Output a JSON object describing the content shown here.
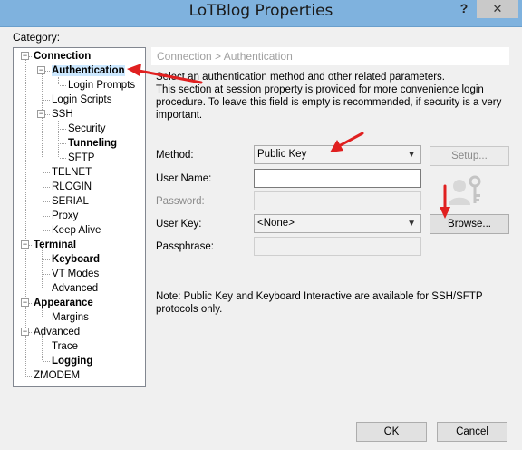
{
  "window": {
    "title": "LoTBlog Properties",
    "help_label": "?",
    "close_label": "✕"
  },
  "category_label": "Category:",
  "tree": [
    {
      "label": "Connection",
      "bold": true,
      "expander": "−"
    },
    {
      "label": "Authentication",
      "bold": true,
      "expander": "−",
      "selected": true
    },
    {
      "label": "Login Prompts",
      "bold": false
    },
    {
      "label": "Login Scripts",
      "bold": false
    },
    {
      "label": "SSH",
      "bold": false,
      "expander": "−"
    },
    {
      "label": "Security",
      "bold": false
    },
    {
      "label": "Tunneling",
      "bold": true
    },
    {
      "label": "SFTP",
      "bold": false
    },
    {
      "label": "TELNET",
      "bold": false
    },
    {
      "label": "RLOGIN",
      "bold": false
    },
    {
      "label": "SERIAL",
      "bold": false
    },
    {
      "label": "Proxy",
      "bold": false
    },
    {
      "label": "Keep Alive",
      "bold": false
    },
    {
      "label": "Terminal",
      "bold": true,
      "expander": "−"
    },
    {
      "label": "Keyboard",
      "bold": true
    },
    {
      "label": "VT Modes",
      "bold": false
    },
    {
      "label": "Advanced",
      "bold": false
    },
    {
      "label": "Appearance",
      "bold": true,
      "expander": "−"
    },
    {
      "label": "Margins",
      "bold": false
    },
    {
      "label": "Advanced",
      "bold": false,
      "expander": "−"
    },
    {
      "label": "Trace",
      "bold": false
    },
    {
      "label": "Logging",
      "bold": true
    },
    {
      "label": "ZMODEM",
      "bold": false
    }
  ],
  "main": {
    "breadcrumb": "Connection > Authentication",
    "description_line1": "Select an authentication method and other related parameters.",
    "description_line2": "This section at session property is provided for more convenience login procedure. To leave this field is empty is recommended, if security is a very important.",
    "method_label": "Method:",
    "method_value": "Public Key",
    "setup_label": "Setup...",
    "username_label": "User Name:",
    "username_value": "",
    "password_label": "Password:",
    "userkey_label": "User Key:",
    "userkey_value": "<None>",
    "browse_label": "Browse...",
    "passphrase_label": "Passphrase:",
    "note": "Note: Public Key and Keyboard Interactive are available for SSH/SFTP protocols only."
  },
  "footer": {
    "ok_label": "OK",
    "cancel_label": "Cancel"
  },
  "colors": {
    "annotation_arrow": "#e02020",
    "selection": "#cce8ff"
  },
  "icons": {
    "key_user": "user-key-icon",
    "dropdown": "chevron-down-icon"
  }
}
